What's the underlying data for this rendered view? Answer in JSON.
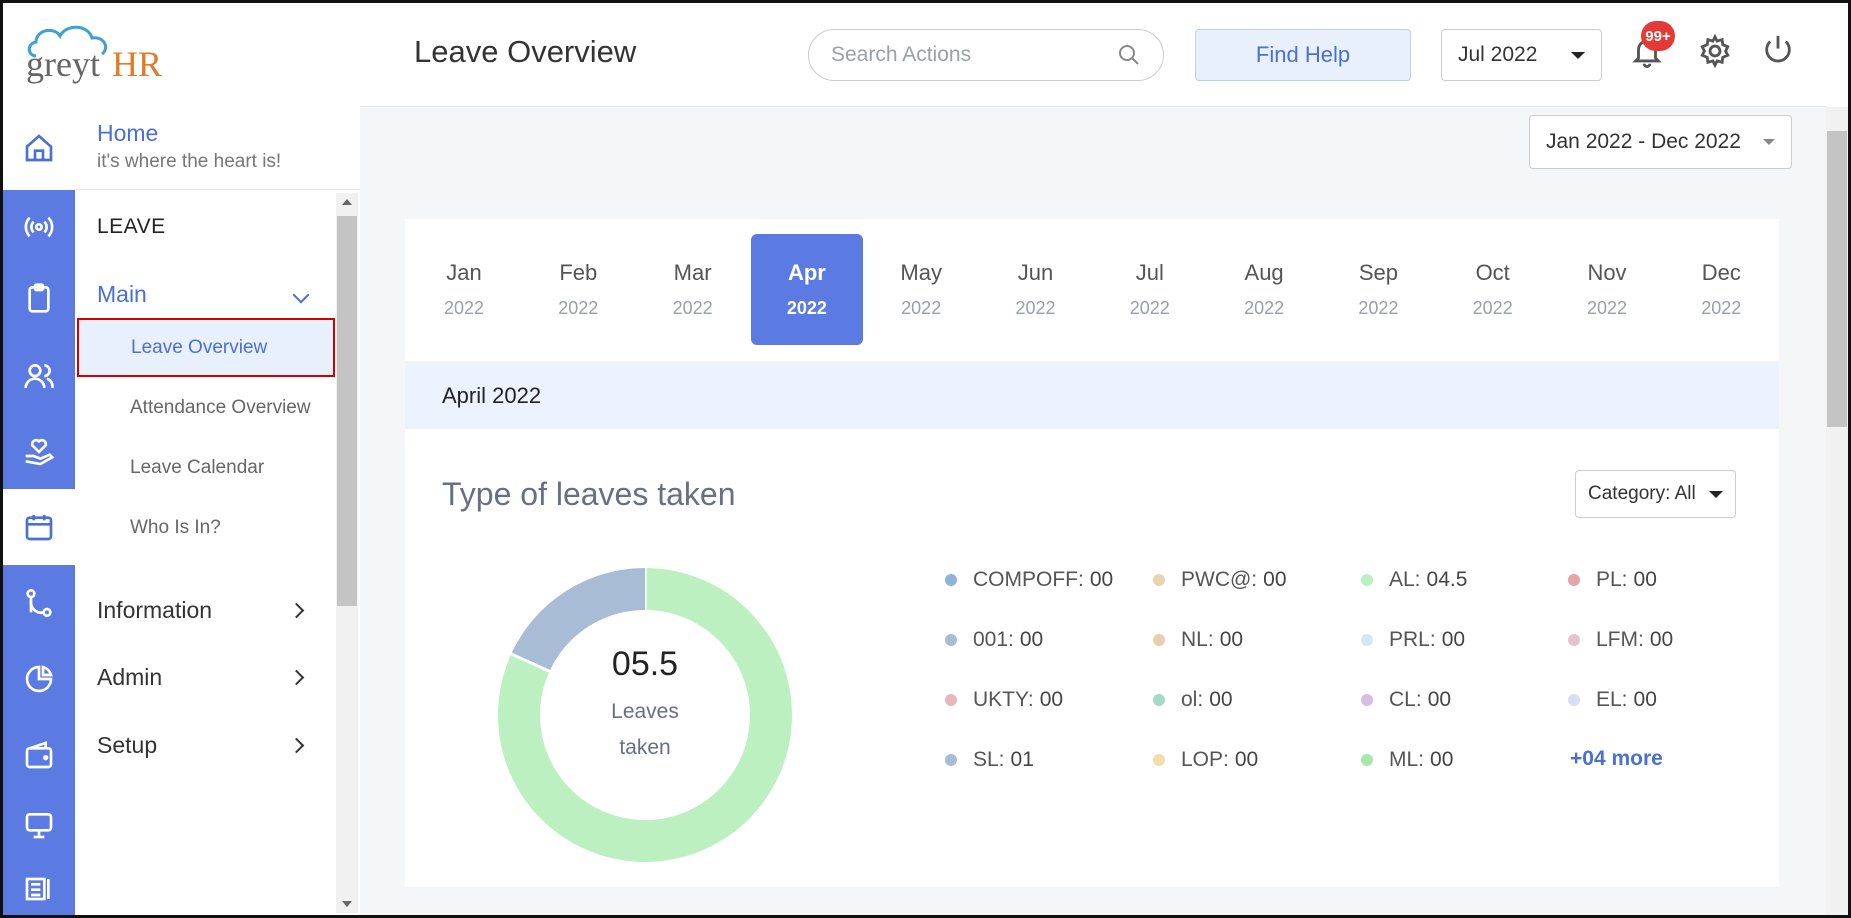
{
  "header": {
    "logo_text_grey": "greyt",
    "logo_text_hr": "HR",
    "title": "Leave Overview",
    "search_placeholder": "Search Actions",
    "find_help": "Find Help",
    "month_selected": "Jul 2022",
    "notification_badge": "99+"
  },
  "menu": {
    "home_title": "Home",
    "home_subtitle": "it's where the heart is!",
    "section_heading": "LEAVE",
    "main_label": "Main",
    "sub_items": [
      "Leave Overview",
      "Attendance Overview",
      "Leave Calendar",
      "Who Is In?"
    ],
    "sections": [
      "Information",
      "Admin",
      "Setup"
    ]
  },
  "content": {
    "range_selected": "Jan 2022 - Dec 2022",
    "months": [
      {
        "m": "Jan",
        "y": "2022"
      },
      {
        "m": "Feb",
        "y": "2022"
      },
      {
        "m": "Mar",
        "y": "2022"
      },
      {
        "m": "Apr",
        "y": "2022"
      },
      {
        "m": "May",
        "y": "2022"
      },
      {
        "m": "Jun",
        "y": "2022"
      },
      {
        "m": "Jul",
        "y": "2022"
      },
      {
        "m": "Aug",
        "y": "2022"
      },
      {
        "m": "Sep",
        "y": "2022"
      },
      {
        "m": "Oct",
        "y": "2022"
      },
      {
        "m": "Nov",
        "y": "2022"
      },
      {
        "m": "Dec",
        "y": "2022"
      }
    ],
    "active_month": "Apr",
    "period_label": "April 2022",
    "leaves_title": "Type of leaves taken",
    "category_select": "Category: All",
    "donut_value": "05.5",
    "donut_label_1": "Leaves",
    "donut_label_2": "taken",
    "more_link": "+04 more"
  },
  "chart_data": {
    "type": "pie",
    "series": [
      {
        "name": "AL",
        "value": 4.5,
        "color": "#bdf0c0"
      },
      {
        "name": "SL",
        "value": 1,
        "color": "#a8bcd6"
      }
    ],
    "total": 5.5
  },
  "legend": [
    {
      "code": "COMPOFF:",
      "value": "00",
      "color": "#8fb3dc"
    },
    {
      "code": "PWC@:",
      "value": "00",
      "color": "#e8d4b0"
    },
    {
      "code": "AL:",
      "value": "04.5",
      "color": "#bdf0c0"
    },
    {
      "code": "PL:",
      "value": "00",
      "color": "#e8a3a6"
    },
    {
      "code": "001:",
      "value": "00",
      "color": "#a8bcd6"
    },
    {
      "code": "NL:",
      "value": "00",
      "color": "#e8cdb0"
    },
    {
      "code": "PRL:",
      "value": "00",
      "color": "#d4e8f4"
    },
    {
      "code": "LFM:",
      "value": "00",
      "color": "#e8c2ce"
    },
    {
      "code": "UKTY:",
      "value": "00",
      "color": "#e4b8b8"
    },
    {
      "code": "ol:",
      "value": "00",
      "color": "#a6d8c8"
    },
    {
      "code": "CL:",
      "value": "00",
      "color": "#d6bde4"
    },
    {
      "code": "EL:",
      "value": "00",
      "color": "#d8def4"
    },
    {
      "code": "SL:",
      "value": "01",
      "color": "#a8bcd6"
    },
    {
      "code": "LOP:",
      "value": "00",
      "color": "#f4dcab"
    },
    {
      "code": "ML:",
      "value": "00",
      "color": "#a6e6a8"
    }
  ]
}
